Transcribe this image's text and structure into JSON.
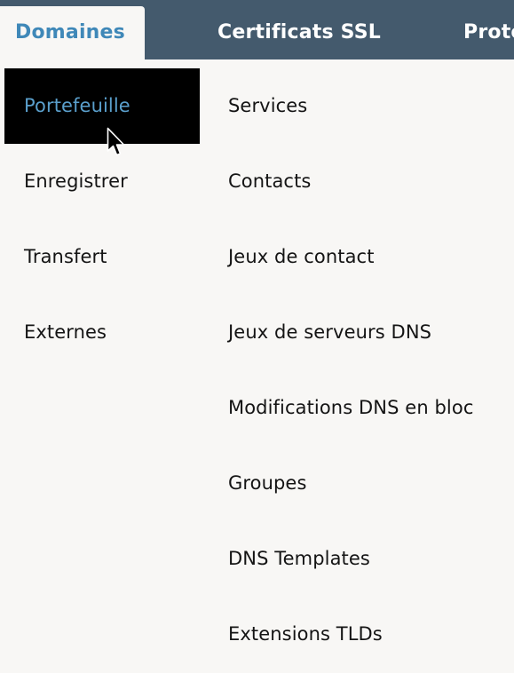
{
  "nav": {
    "tabs": [
      {
        "label": "Domaines",
        "active": true
      },
      {
        "label": "Certificats SSL",
        "active": false
      },
      {
        "label": "Prote",
        "active": false
      }
    ]
  },
  "menu": {
    "left": [
      {
        "label": "Portefeuille",
        "hovered": true
      },
      {
        "label": "Enregistrer"
      },
      {
        "label": "Transfert"
      },
      {
        "label": "Externes"
      }
    ],
    "right": [
      {
        "label": "Services"
      },
      {
        "label": "Contacts"
      },
      {
        "label": "Jeux de contact"
      },
      {
        "label": "Jeux de serveurs DNS"
      },
      {
        "label": "Modifications DNS en bloc"
      },
      {
        "label": "Groupes"
      },
      {
        "label": "DNS Templates"
      },
      {
        "label": "Extensions TLDs"
      }
    ]
  },
  "colors": {
    "nav_background": "#445a6d",
    "active_tab_text": "#3f88b8",
    "hover_background": "#000000",
    "hover_text": "#5a9fcc",
    "page_background": "#f8f7f5"
  }
}
